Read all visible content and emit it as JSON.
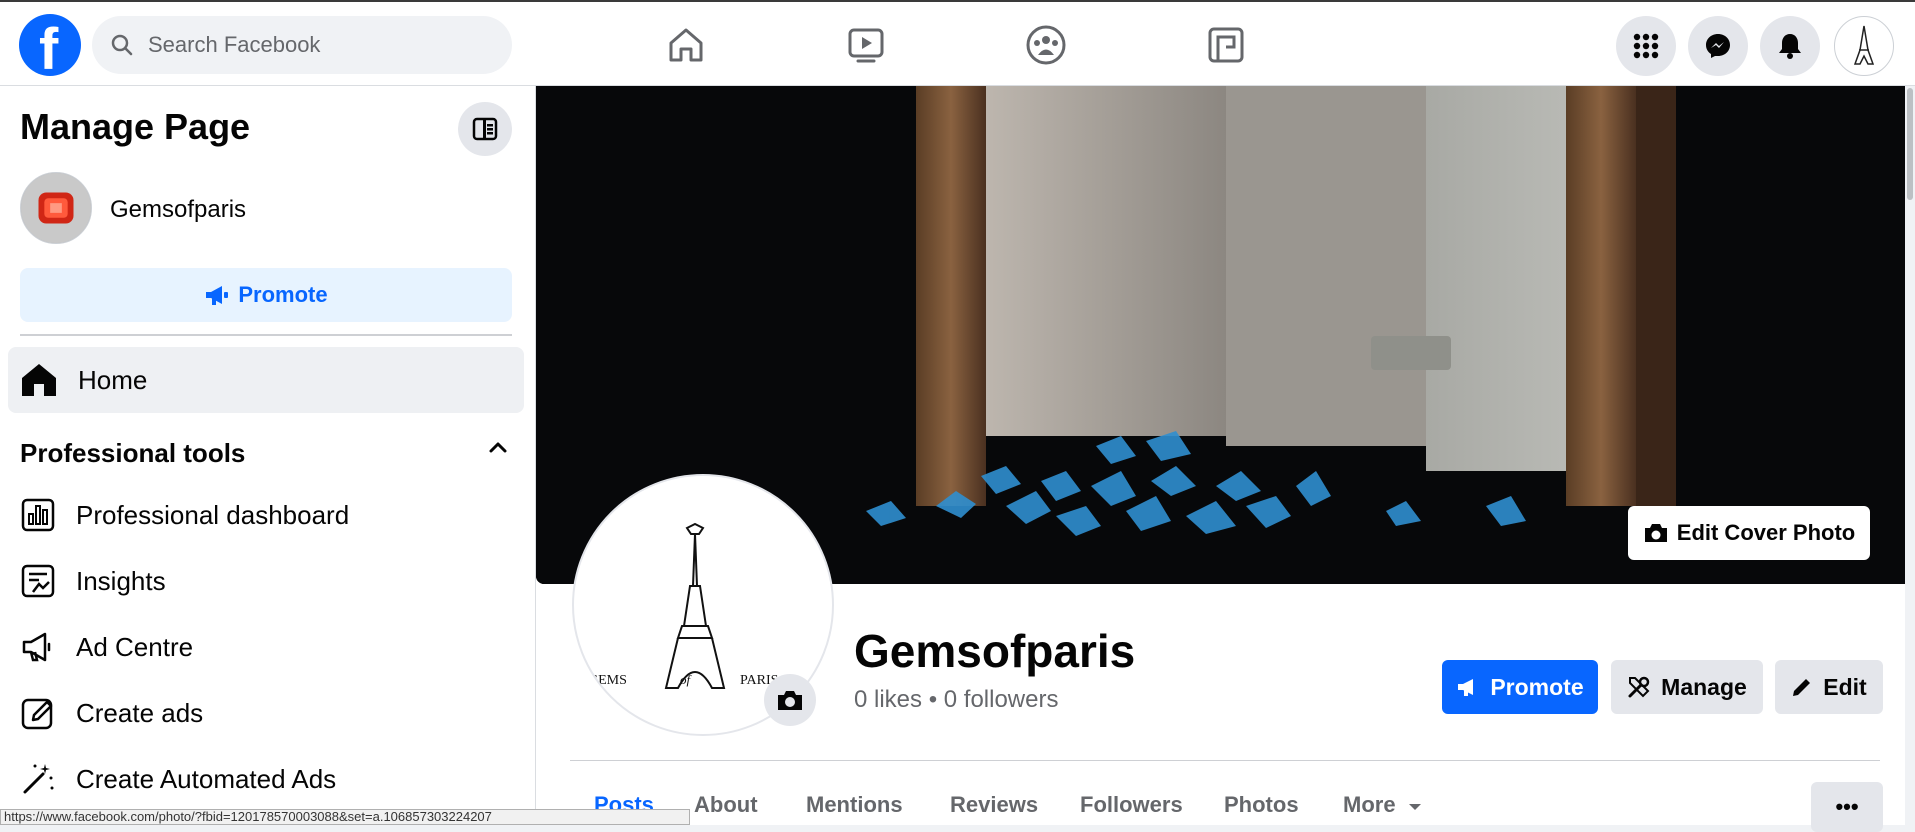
{
  "topbar": {
    "logo_letter": "f",
    "search_placeholder": "Search Facebook",
    "nav_icons": [
      "home-icon",
      "video-icon",
      "groups-icon",
      "gaming-icon"
    ],
    "right_icons": [
      "menu-grid-icon",
      "messenger-icon",
      "notifications-icon"
    ]
  },
  "sidebar": {
    "title": "Manage Page",
    "page_name": "Gemsofparis",
    "promote_label": "Promote",
    "home_label": "Home",
    "section_title": "Professional tools",
    "items": [
      {
        "label": "Professional dashboard",
        "icon": "dashboard-icon"
      },
      {
        "label": "Insights",
        "icon": "insights-icon"
      },
      {
        "label": "Ad Centre",
        "icon": "megaphone-icon"
      },
      {
        "label": "Create ads",
        "icon": "edit-square-icon"
      },
      {
        "label": "Create Automated Ads",
        "icon": "magic-wand-icon"
      }
    ]
  },
  "main": {
    "edit_cover_label": "Edit Cover Photo",
    "logo_text": {
      "left": "GEMS",
      "mid": "of",
      "right": "PARIS"
    },
    "page_name": "Gemsofparis",
    "stats": "0 likes • 0 followers",
    "buttons": {
      "promote": "Promote",
      "manage": "Manage",
      "edit": "Edit"
    },
    "tabs": [
      "Posts",
      "About",
      "Mentions",
      "Reviews",
      "Followers",
      "Photos",
      "More"
    ],
    "more_dots": "•••"
  },
  "status_bar": "https://www.facebook.com/photo/?fbid=120178570003088&set=a.106857303224207",
  "colors": {
    "accent": "#0866ff",
    "accent_light": "#e7f3ff",
    "grey_button": "#e4e6eb"
  }
}
